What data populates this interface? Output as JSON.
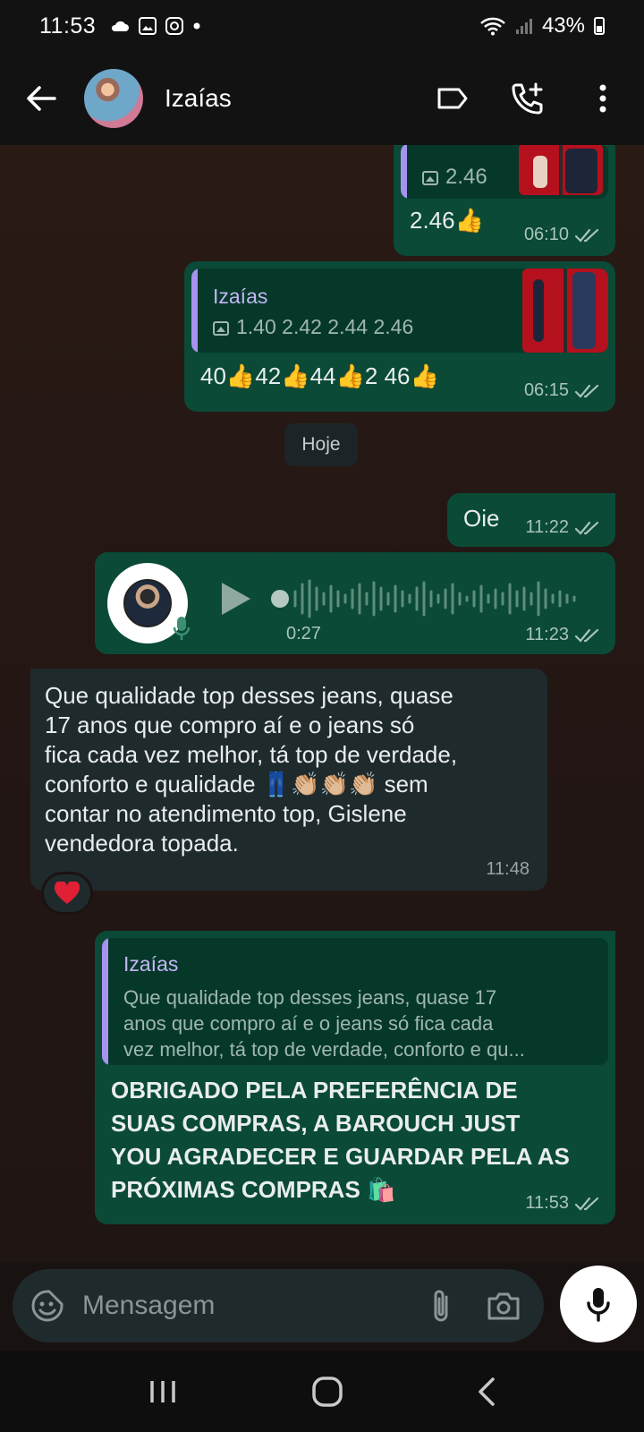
{
  "status_bar": {
    "time": "11:53",
    "battery": "43%",
    "notification_icons": [
      "cloud-icon",
      "gallery-icon",
      "instagram-icon",
      "dot-icon"
    ]
  },
  "header": {
    "contact_name": "Izaías"
  },
  "messages": {
    "m1": {
      "caption": "2.46",
      "text": "2.46",
      "emoji": "👍",
      "time": "06:10"
    },
    "m2": {
      "quote_name": "Izaías",
      "quote_caption": "1.40 2.42 2.44 2.46",
      "text": "40👍42👍44👍2 46👍",
      "time": "06:15"
    },
    "date_chip": "Hoje",
    "m3": {
      "text": "Oie",
      "time": "11:22"
    },
    "m4": {
      "duration": "0:27",
      "time": "11:23"
    },
    "m5": {
      "lines": [
        "Que qualidade top desses jeans, quase",
        "17 anos que compro aí e o jeans só",
        "fica cada vez melhor, tá top de verdade,",
        "conforto e qualidade 👖👏🏼👏🏼👏🏼 sem",
        "contar no atendimento top, Gislene",
        "vendedora topada."
      ],
      "time": "11:48",
      "reaction": "❤️"
    },
    "m6": {
      "quote_name": "Izaías",
      "quote_lines": [
        "Que qualidade top desses jeans, quase 17",
        "anos que compro aí e o jeans só fica cada",
        "vez melhor, tá top de verdade, conforto e qu..."
      ],
      "lines": [
        "OBRIGADO PELA PREFERÊNCIA DE",
        "SUAS COMPRAS,  A BAROUCH JUST",
        "YOU AGRADECER E GUARDAR PELA AS",
        "PRÓXIMAS COMPRAS 🛍️"
      ],
      "time": "11:53"
    }
  },
  "input": {
    "placeholder": "Mensagem"
  },
  "colors": {
    "outgoing_bubble": "#0a4a37",
    "incoming_bubble": "#1f2a2d",
    "quote_accent": "#a792ef"
  }
}
